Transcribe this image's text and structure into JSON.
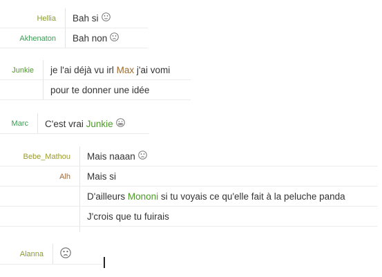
{
  "colors": {
    "hellia": "#8a9b2a",
    "akhenaton": "#3e9a55",
    "junkie": "#4b9a27",
    "marc": "#3e9a55",
    "bebe_mathou": "#9a9a2a",
    "alh": "#a0693a",
    "alanna": "#8a9b2a",
    "max": "#a06a2a",
    "mononi": "#4b9a27",
    "text": "#333333"
  },
  "chat": {
    "g1": {
      "r1": {
        "user": "Hellia",
        "text": "Bah si",
        "emoji": "neutral-face-icon"
      },
      "r2": {
        "user": "Akhenaton",
        "text": "Bah non",
        "emoji": "sad-face-icon"
      }
    },
    "g2": {
      "r1": {
        "user": "Junkie",
        "pre": "je l'ai déjà vu irl ",
        "mention": "Max",
        "post": " j'ai vomi"
      },
      "r2": {
        "text": "pour te donner une idée"
      }
    },
    "g3": {
      "r1": {
        "user": "Marc",
        "pre": "C'est vrai ",
        "mention": "Junkie",
        "emoji": "grimace-face-icon"
      }
    },
    "g4": {
      "r1": {
        "user": "Bebe_Mathou",
        "text": "Mais naaan",
        "emoji": "sad-face-icon"
      },
      "r2": {
        "user": "Alh",
        "text": "Mais si"
      },
      "r3": {
        "pre": "D'ailleurs ",
        "mention": "Mononi",
        "post": " si tu voyais ce qu'elle fait à la peluche panda"
      },
      "r4": {
        "text": "J'crois que tu fuirais"
      }
    },
    "g5": {
      "r1": {
        "user": "Alanna",
        "emoji": "sad-face-icon"
      }
    }
  }
}
